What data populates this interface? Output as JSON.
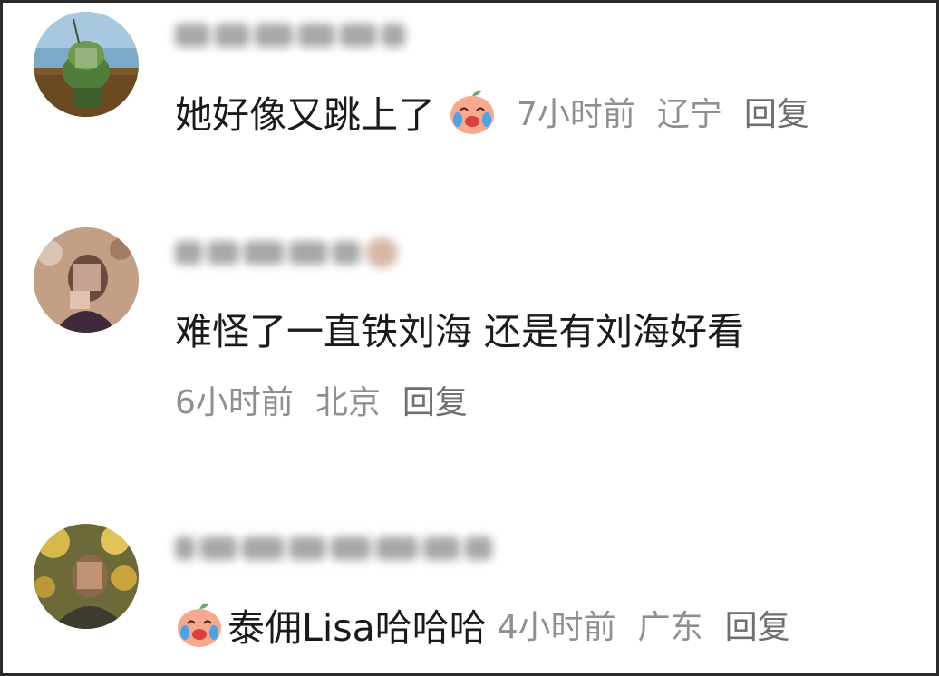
{
  "comments": [
    {
      "text": "她好像又跳上了",
      "emoji": "crying-laughing-peach-icon",
      "time": "7小时前",
      "location": "辽宁",
      "reply_label": "回复"
    },
    {
      "text": "难怪了一直铁刘海 还是有刘海好看",
      "time": "6小时前",
      "location": "北京",
      "reply_label": "回复"
    },
    {
      "emoji": "crying-laughing-peach-icon",
      "text": "泰佣Lisa哈哈哈",
      "time": "4小时前",
      "location": "广东",
      "reply_label": "回复"
    }
  ],
  "colors": {
    "text": "#1a1a1a",
    "meta": "#8f8f8f",
    "border": "#2a2a2a"
  }
}
